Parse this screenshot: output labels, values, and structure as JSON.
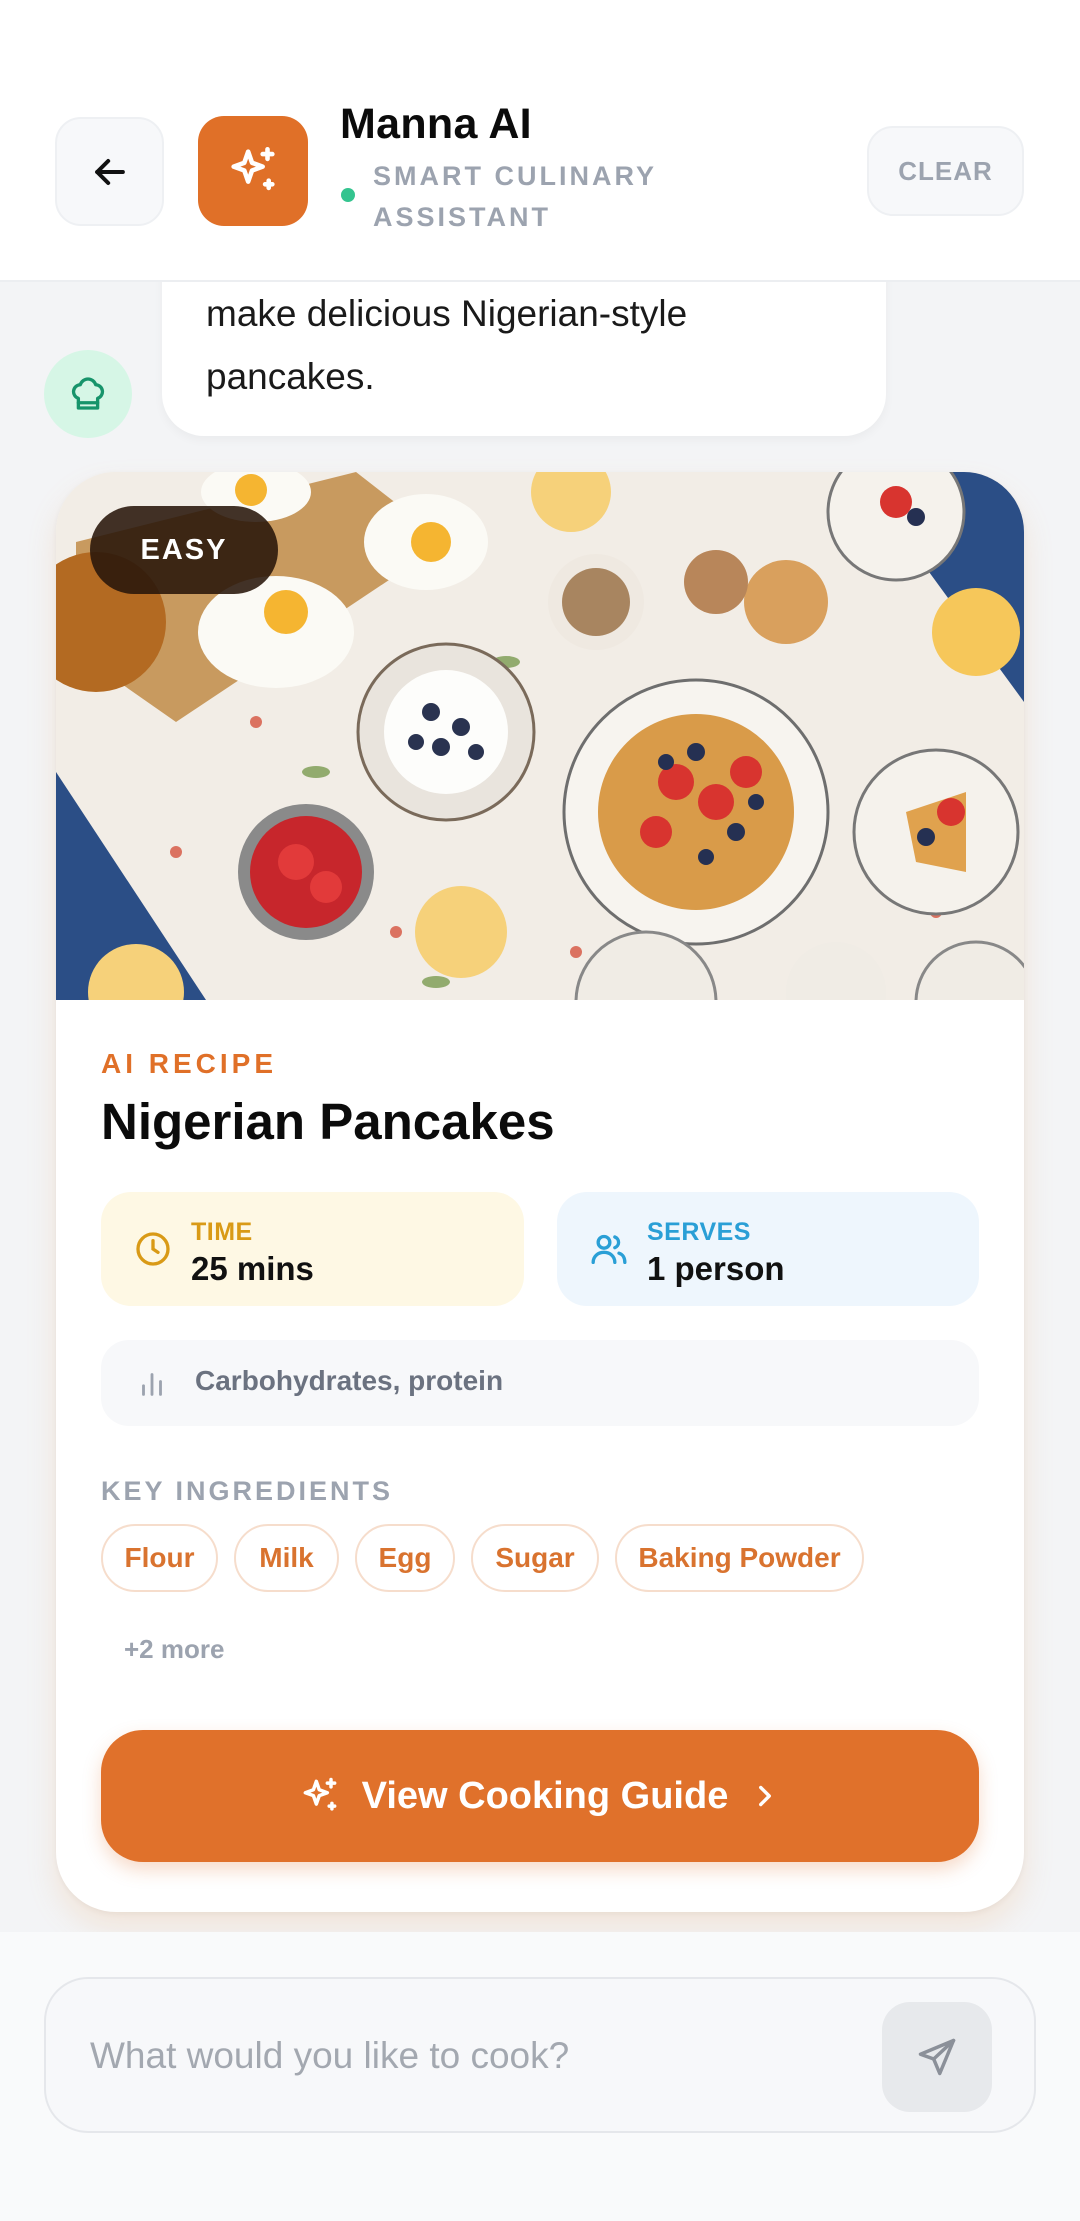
{
  "header": {
    "title": "Manna AI",
    "subtitle": "SMART CULINARY ASSISTANT",
    "clear_label": "CLEAR",
    "status_color": "#34c48f",
    "brand_color": "#e07028"
  },
  "chat": {
    "bot_message_tail": "make delicious Nigerian-style pancakes."
  },
  "recipe": {
    "difficulty": "EASY",
    "eyebrow": "AI RECIPE",
    "title": "Nigerian Pancakes",
    "time": {
      "label": "TIME",
      "value": "25 mins",
      "icon": "clock-icon"
    },
    "serves": {
      "label": "SERVES",
      "value": "1 person",
      "icon": "users-icon"
    },
    "nutrition": {
      "text": "Carbohydrates, protein",
      "icon": "bar-chart-icon"
    },
    "ingredients_label": "KEY INGREDIENTS",
    "ingredients": [
      "Flour",
      "Milk",
      "Egg",
      "Sugar",
      "Baking Powder"
    ],
    "more_label": "+2 more",
    "cta_label": "View Cooking Guide"
  },
  "composer": {
    "placeholder": "What would you like to cook?",
    "value": ""
  }
}
